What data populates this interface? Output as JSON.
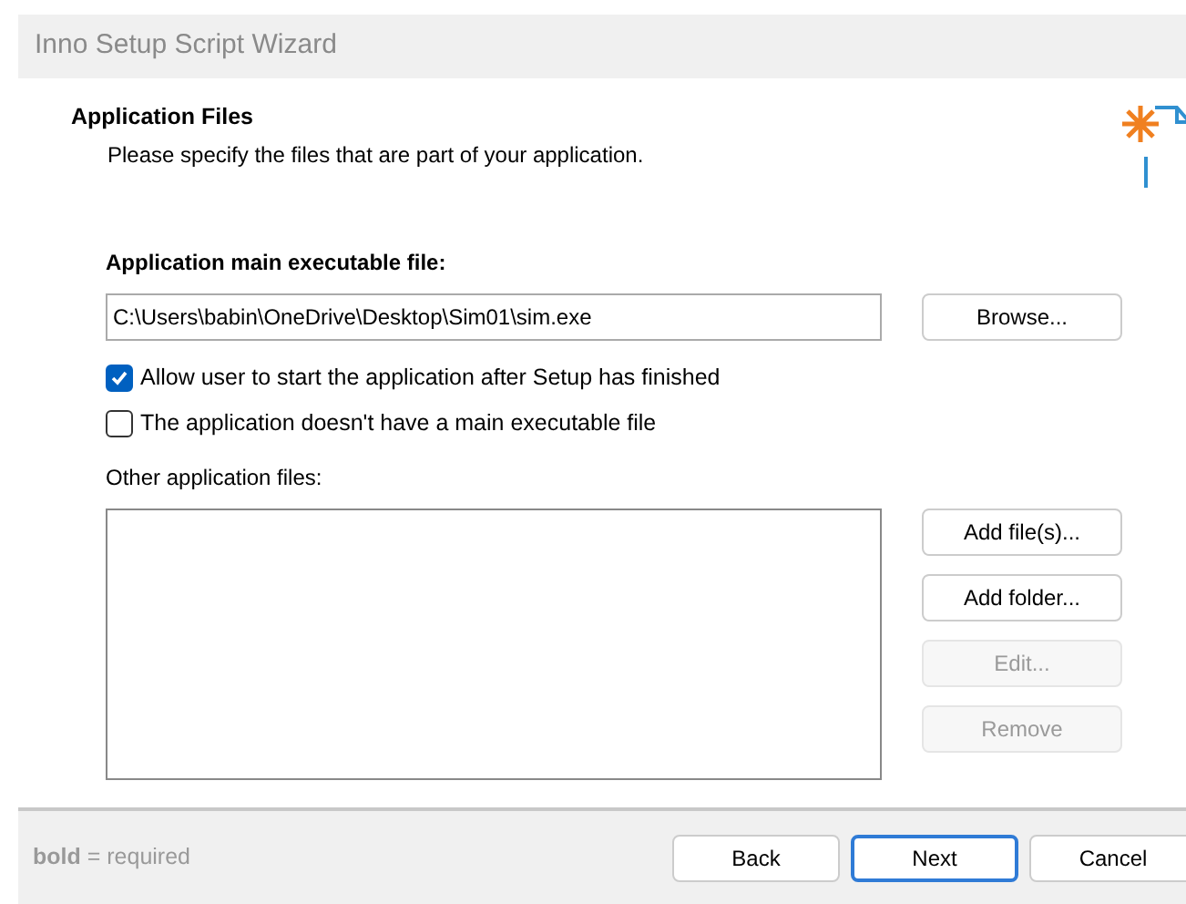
{
  "window": {
    "title": "Inno Setup Script Wizard"
  },
  "header": {
    "title": "Application Files",
    "subtitle": "Please specify the files that are part of your application."
  },
  "main_executable": {
    "label": "Application main executable file:",
    "value": "C:\\Users\\babin\\OneDrive\\Desktop\\Sim01\\sim.exe",
    "browse": "Browse..."
  },
  "options": [
    {
      "label": "Allow user to start the application after Setup has finished",
      "checked": true
    },
    {
      "label": "The application doesn't have a main executable file",
      "checked": false
    }
  ],
  "other_files": {
    "label": "Other application files:",
    "buttons": [
      {
        "label": "Add file(s)...",
        "disabled": false
      },
      {
        "label": "Add folder...",
        "disabled": false
      },
      {
        "label": "Edit...",
        "disabled": true
      },
      {
        "label": "Remove",
        "disabled": true
      }
    ]
  },
  "footer": {
    "note": "**bold** = required",
    "buttons": [
      {
        "label": "Back",
        "default": false
      },
      {
        "label": "Next",
        "default": true
      },
      {
        "label": "Cancel",
        "default": false
      }
    ]
  }
}
